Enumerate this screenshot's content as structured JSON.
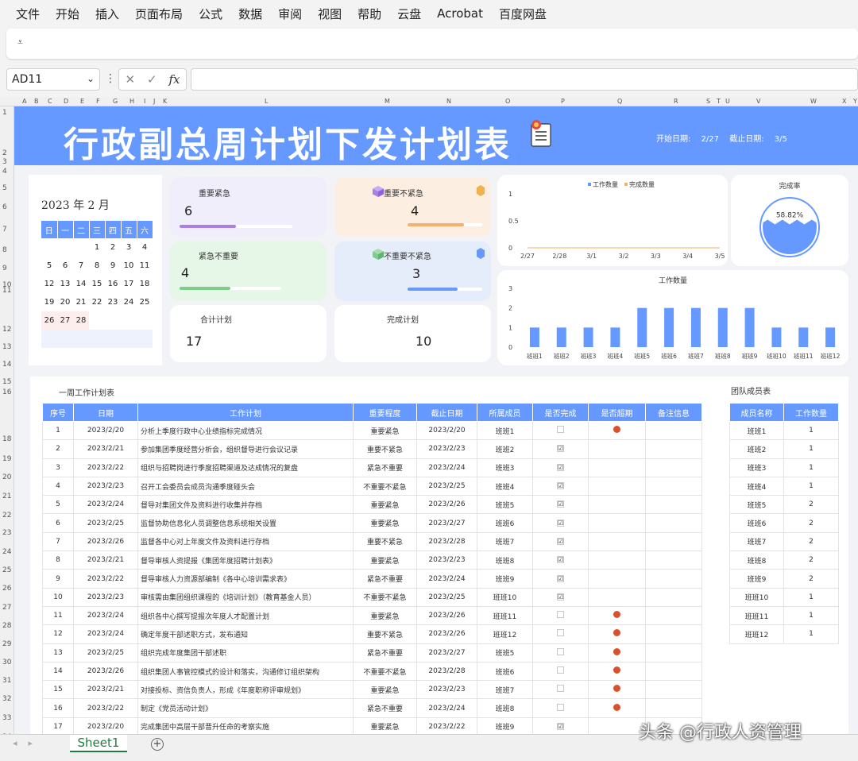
{
  "menu": [
    "文件",
    "开始",
    "插入",
    "页面布局",
    "公式",
    "数据",
    "审阅",
    "视图",
    "帮助",
    "云盘",
    "Acrobat",
    "百度网盘"
  ],
  "formula_bar": {
    "cell_ref": "AD11",
    "fx": "fx",
    "value": ""
  },
  "columns": [
    "A",
    "B",
    "C",
    "D",
    "E",
    "F",
    "G",
    "H",
    "I",
    "J",
    "K",
    "L",
    "M",
    "N",
    "O",
    "P",
    "Q",
    "R",
    "S",
    "T",
    "U",
    "V",
    "W",
    "X",
    "Y"
  ],
  "rows": [
    "1",
    "2",
    "3",
    "4",
    "5",
    "6",
    "7",
    "8",
    "9",
    "10",
    "11",
    "12",
    "13",
    "14",
    "15",
    "16",
    "18",
    "19",
    "20",
    "21",
    "22",
    "23",
    "24",
    "25",
    "26",
    "27",
    "28",
    "29",
    "30",
    "31",
    "32",
    "33",
    "34",
    "35",
    "36",
    "37"
  ],
  "banner": {
    "title": "行政副总周计划下发计划表",
    "start_label": "开始日期:",
    "start_value": "2/27",
    "end_label": "截止日期:",
    "end_value": "3/5",
    "colors": {
      "banner": "#6699ff"
    }
  },
  "calendar": {
    "year_month": "2023 年 2 月",
    "weekdays": [
      "日",
      "一",
      "二",
      "三",
      "四",
      "五",
      "六"
    ],
    "weeks": [
      [
        "",
        "",
        "",
        "1",
        "2",
        "3",
        "4"
      ],
      [
        "5",
        "6",
        "7",
        "8",
        "9",
        "10",
        "11"
      ],
      [
        "12",
        "13",
        "14",
        "15",
        "16",
        "17",
        "18"
      ],
      [
        "19",
        "20",
        "21",
        "22",
        "23",
        "24",
        "25"
      ],
      [
        "26",
        "27",
        "28",
        "",
        "",
        "",
        ""
      ],
      [
        "",
        "",
        "",
        "",
        "",
        "",
        ""
      ]
    ]
  },
  "cards": {
    "important_urgent": {
      "label": "重要紧急",
      "value": "6",
      "progress": 0.5
    },
    "important_not_urgent": {
      "label": "重要不紧急",
      "value": "4",
      "progress": 0.75
    },
    "urgent_not_important": {
      "label": "紧急不重要",
      "value": "4",
      "progress": 0.5
    },
    "not_important_not_urgent": {
      "label": "不重要不紧急",
      "value": "3",
      "progress": 0.67
    },
    "total_plans": {
      "label": "合计计划",
      "value": "17"
    },
    "done_plans": {
      "label": "完成计划",
      "value": "10"
    }
  },
  "chart_data": [
    {
      "type": "line",
      "series": [
        {
          "name": "工作数量",
          "values": [
            0,
            0,
            0,
            0,
            0,
            0,
            0
          ]
        },
        {
          "name": "完成数量",
          "values": [
            0,
            0,
            0,
            0,
            0,
            0,
            0
          ]
        }
      ],
      "x": [
        "2/27",
        "2/28",
        "3/1",
        "3/2",
        "3/3",
        "3/4",
        "3/5"
      ],
      "yticks": [
        "1",
        "0.5",
        "0"
      ],
      "ylim": [
        0,
        1
      ],
      "legend": "top",
      "colors": {
        "工作数量": "#6699ff",
        "完成数量": "#f5b06b"
      }
    },
    {
      "type": "gauge",
      "title": "完成率",
      "value": 58.82,
      "value_label": "58.82%",
      "colors": {
        "fill": "#6699ff",
        "ring": "#6699ff"
      }
    },
    {
      "type": "bar",
      "title": "工作数量",
      "categories": [
        "班班1",
        "班班2",
        "班班3",
        "班班4",
        "班班5",
        "班班6",
        "班班7",
        "班班8",
        "班班9",
        "班班10",
        "班班11",
        "班班12"
      ],
      "values": [
        1,
        1,
        1,
        1,
        2,
        2,
        2,
        2,
        2,
        1,
        1,
        1
      ],
      "yticks": [
        "3",
        "2",
        "1",
        "0"
      ],
      "ylim": [
        0,
        3
      ],
      "colors": {
        "bar": "#6699ff"
      }
    }
  ],
  "weekly_table": {
    "title": "一周工作计划表",
    "headers": [
      "序号",
      "日期",
      "工作计划",
      "重要程度",
      "截止日期",
      "所属成员",
      "是否完成",
      "是否超期",
      "备注信息"
    ],
    "rows": [
      [
        "1",
        "2023/2/20",
        "分析上季度行政中心业绩指标完成情况",
        "重要紧急",
        "2023/2/20",
        "班班1",
        "",
        "●",
        ""
      ],
      [
        "2",
        "2023/2/21",
        "参加集团季度经营分析会，组织督导进行会议记录",
        "重要不紧急",
        "2023/2/23",
        "班班2",
        "☑",
        "",
        ""
      ],
      [
        "3",
        "2023/2/22",
        "组织与招聘岗进行季度招聘渠道及达成情况的复盘",
        "紧急不重要",
        "2023/2/24",
        "班班3",
        "☑",
        "",
        ""
      ],
      [
        "4",
        "2023/2/23",
        "召开工会委员会成员沟通季度碰头会",
        "不重要不紧急",
        "2023/2/25",
        "班班4",
        "☑",
        "",
        ""
      ],
      [
        "5",
        "2023/2/24",
        "督导对集团文件及资料进行收集并存档",
        "重要紧急",
        "2023/2/26",
        "班班5",
        "☑",
        "",
        ""
      ],
      [
        "6",
        "2023/2/25",
        "监督协助信息化人员调整信息系统相关设置",
        "重要紧急",
        "2023/2/27",
        "班班6",
        "☑",
        "",
        ""
      ],
      [
        "7",
        "2023/2/26",
        "监督各中心对上年度文件及资料进行存档",
        "重要不紧急",
        "2023/2/28",
        "班班7",
        "☑",
        "",
        ""
      ],
      [
        "8",
        "2023/2/21",
        "督导审核人资提报《集团年度招聘计划表》",
        "重要紧急",
        "2023/2/23",
        "班班8",
        "☑",
        "",
        ""
      ],
      [
        "9",
        "2023/2/22",
        "督导审核人力资源部编制《各中心培训需求表》",
        "紧急不重要",
        "2023/2/24",
        "班班9",
        "☑",
        "",
        ""
      ],
      [
        "10",
        "2023/2/23",
        "审核需由集团组织课程的《培训计划》（教育基金人员）",
        "不重要不紧急",
        "2023/2/25",
        "班班10",
        "☑",
        "",
        ""
      ],
      [
        "11",
        "2023/2/24",
        "组织各中心撰写提报次年度人才配置计划",
        "重要紧急",
        "2023/2/26",
        "班班11",
        "",
        "●",
        ""
      ],
      [
        "12",
        "2023/2/24",
        "确定年度干部述职方式，发布通知",
        "重要不紧急",
        "2023/2/26",
        "班班12",
        "",
        "●",
        ""
      ],
      [
        "13",
        "2023/2/25",
        "组织完成年度集团干部述职",
        "紧急不重要",
        "2023/2/27",
        "班班5",
        "",
        "●",
        ""
      ],
      [
        "14",
        "2023/2/26",
        "组织集团人事管控模式的设计和落实，沟通修订组织架构",
        "不重要不紧急",
        "2023/2/28",
        "班班6",
        "",
        "●",
        ""
      ],
      [
        "15",
        "2023/2/21",
        "对接投标、资信负责人，形成《年度职称评审规划》",
        "重要紧急",
        "2023/2/23",
        "班班7",
        "",
        "●",
        ""
      ],
      [
        "16",
        "2023/2/22",
        "制定《党员活动计划》",
        "紧急不重要",
        "2023/2/24",
        "班班8",
        "",
        "●",
        ""
      ],
      [
        "17",
        "2023/2/20",
        "完成集团中高层干部晋升任命的考察实施",
        "重要紧急",
        "2023/2/22",
        "班班9",
        "☑",
        "",
        ""
      ]
    ]
  },
  "team_table": {
    "title": "团队成员表",
    "headers": [
      "成员名称",
      "工作数量"
    ],
    "rows": [
      [
        "班班1",
        "1"
      ],
      [
        "班班2",
        "1"
      ],
      [
        "班班3",
        "1"
      ],
      [
        "班班4",
        "1"
      ],
      [
        "班班5",
        "2"
      ],
      [
        "班班6",
        "2"
      ],
      [
        "班班7",
        "2"
      ],
      [
        "班班8",
        "2"
      ],
      [
        "班班9",
        "2"
      ],
      [
        "班班10",
        "1"
      ],
      [
        "班班11",
        "1"
      ],
      [
        "班班12",
        "1"
      ]
    ]
  },
  "sheet_tabs": {
    "active": "Sheet1",
    "add": "+"
  },
  "watermark": "头条 @行政人资管理"
}
